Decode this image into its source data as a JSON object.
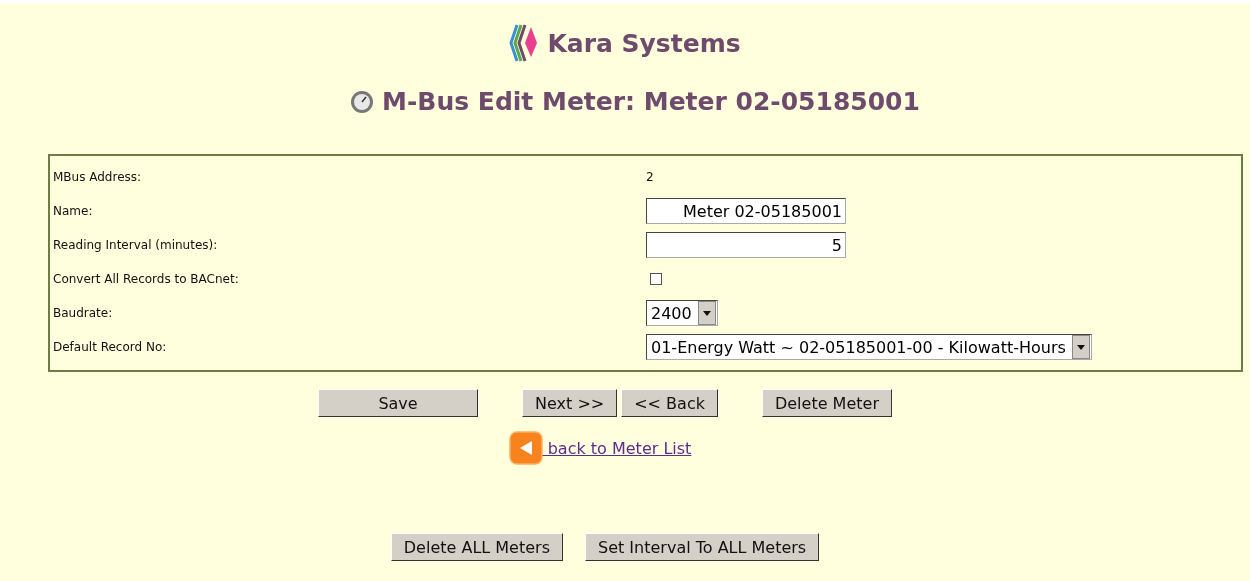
{
  "brand": {
    "name": "Kara Systems"
  },
  "heading": "M-Bus Edit Meter: Meter 02-05185001",
  "fields": [
    {
      "label": "MBus Address:",
      "kind": "text",
      "value": "2"
    },
    {
      "label": "Name:",
      "kind": "input",
      "value": "Meter 02-05185001"
    },
    {
      "label": "Reading Interval (minutes):",
      "kind": "input",
      "value": "5"
    },
    {
      "label": "Convert All Records to BACnet:",
      "kind": "checkbox",
      "checked": false
    },
    {
      "label": "Baudrate:",
      "kind": "select",
      "value": "2400"
    },
    {
      "label": "Default Record No:",
      "kind": "select",
      "value": "01-Energy Watt ~ 02-05185001-00 - Kilowatt-Hours"
    }
  ],
  "button_groups": [
    [
      "Save"
    ],
    [
      "Next >>",
      "<< Back"
    ],
    [
      "Delete Meter"
    ]
  ],
  "back_link": " back to Meter List",
  "bottom_buttons": [
    "Delete ALL Meters",
    "Set Interval To ALL Meters"
  ]
}
